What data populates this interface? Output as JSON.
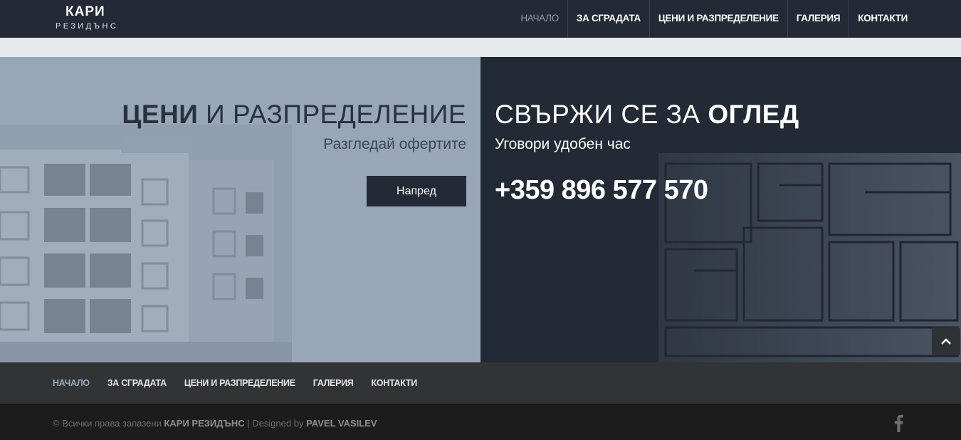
{
  "header": {
    "logo_top": "КАРИ",
    "logo_bottom": "РЕЗИДЪНС",
    "nav": [
      {
        "label": "НАЧАЛО"
      },
      {
        "label": "ЗА СГРАДАТА"
      },
      {
        "label": "ЦЕНИ И РАЗПРЕДЕЛЕНИЕ"
      },
      {
        "label": "ГАЛЕРИЯ"
      },
      {
        "label": "КОНТАКТИ"
      }
    ]
  },
  "hero_left": {
    "title_bold": "ЦЕНИ",
    "title_rest": " И РАЗПРЕДЕЛЕНИЕ",
    "subtitle": "Разгледай офертите",
    "button": "Напред"
  },
  "hero_right": {
    "title_rest": "СВЪРЖИ СЕ ЗА ",
    "title_bold": "ОГЛЕД",
    "subtitle": "Уговори удобен час",
    "phone": "+359 896 577 570"
  },
  "footer_nav": [
    {
      "label": "НАЧАЛО"
    },
    {
      "label": "ЗА СГРАДАТА"
    },
    {
      "label": "ЦЕНИ И РАЗПРЕДЕЛЕНИЕ"
    },
    {
      "label": "ГАЛЕРИЯ"
    },
    {
      "label": "КОНТАКТИ"
    }
  ],
  "footer": {
    "copy_prefix": "© Всички права запазени ",
    "brand": "КАРИ РЕЗИДЪНС",
    "separator": " | Designed by ",
    "designer": "PAVEL VASILEV"
  },
  "icons": {
    "scroll_top": "chevron-up-icon",
    "social": "facebook-icon"
  },
  "colors": {
    "header_bg": "#232a36",
    "left_panel_bg": "#98a7b8",
    "right_panel_bg": "#232a36",
    "footer_nav_bg": "#323334",
    "footer_bg": "#1c1c1c",
    "accent_active": "#8e9bab"
  }
}
